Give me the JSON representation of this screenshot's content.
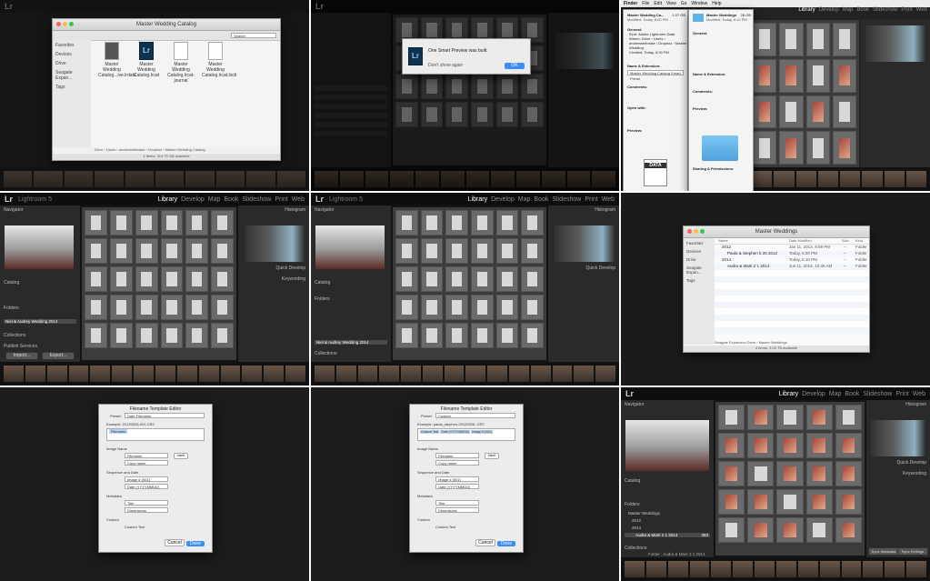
{
  "cell1": {
    "window_title": "Master Wedding Catalog",
    "sidebar": [
      "Favorites",
      "Devices",
      "Drive",
      "Seagate Expan...",
      "Tags"
    ],
    "files": [
      "Master Wedding Catalog...ive.lrdata",
      "Master Wedding Catalog.lrcat",
      "Master Wedding Catalog.lrcat-journal",
      "Master Wedding Catalog.lrcat.lock"
    ],
    "status": "4 items, 319.75 GB available",
    "search_placeholder": "Search",
    "path": "Drive › Users › andrewsinfosise › Dropbox › Master Wedding Catalog"
  },
  "cell2": {
    "dialog_text": "One Smart Preview was built.",
    "checkbox": "Don't show again",
    "ok": "OK",
    "icon": "Lr"
  },
  "cell3": {
    "menubar": [
      "Finder",
      "File",
      "Edit",
      "View",
      "Go",
      "Window",
      "Help"
    ],
    "info1_title": "Master Wedding Ca...",
    "info1_size": "1.07 GB",
    "info1_modified": "Modified: Today, 6:00 PM",
    "info2_title": "Master Weddings",
    "info2_size": "28 GB",
    "info2_modified": "Modified: Today, 6:10 PM",
    "general": "General:",
    "kind1": "Kind: Adobe Lightroom Data",
    "where": "Where: Drive › Users › andrewsinfosise › Dropbox › Master Wedding",
    "created": "Created: Today, 6:00 PM",
    "name_ext": "Name & Extension:",
    "name_value": "Master Wedding Catalog Smart Previe",
    "comments": "Comments:",
    "open_with": "Open with:",
    "preview": "Preview:",
    "sharing": "Sharing & Permissions:",
    "data_label": "DATA",
    "module_tabs": [
      "Library",
      "Develop",
      "Map",
      "Book",
      "Slideshow",
      "Print",
      "Web"
    ]
  },
  "lr_modules": [
    "Library",
    "Develop",
    "Map",
    "Book",
    "Slideshow",
    "Print",
    "Web"
  ],
  "lr_logo": "Lr",
  "lr_logo_text": "Lightroom 5",
  "lr_panels": {
    "navigator": "Navigator",
    "catalog": "Catalog",
    "folders": "Folders",
    "collections": "Collections",
    "publish": "Publish Services",
    "histogram": "Histogram",
    "quick_develop": "Quick Develop",
    "keywording": "Keywording",
    "import": "Import...",
    "export": "Export...",
    "folder_item": "Niel & Audrey Wedding 2014",
    "sync": "Sync Settings",
    "sync_meta": "Sync Metadata"
  },
  "cell6": {
    "window_title": "Master Weddings",
    "columns": [
      "Name",
      "Date Modified",
      "Size",
      "Kind"
    ],
    "rows": [
      {
        "name": "2012",
        "date": "Jan 11, 2013, 8:59 PM",
        "size": "--",
        "kind": "Folder"
      },
      {
        "name": "Paula & Stephen 5 26 2012",
        "date": "Today, 6:30 PM",
        "size": "--",
        "kind": "Folder"
      },
      {
        "name": "2014",
        "date": "Today, 6:10 PM",
        "size": "--",
        "kind": "Folder"
      },
      {
        "name": "Audra & Mark 2 1 2014",
        "date": "Jun 11, 2014, 10:35 AM",
        "size": "--",
        "kind": "Folder"
      }
    ],
    "status": "4 items, 3.00 TB available",
    "path": "Seagate Expansion Drive › Master Weddings",
    "sidebar": [
      "Favorites",
      "Devices",
      "Drive",
      "Seagate Expan...",
      "Tags"
    ]
  },
  "cell7": {
    "title": "Filename Template Editor",
    "preset_label": "Preset:",
    "preset_value": "Date-Filename",
    "example": "Example: 20120526-001.CR2",
    "token": "Filename",
    "image_name": "Image Name",
    "filename": "Filename",
    "copy_name": "Copy name",
    "seq": "Sequence and Date",
    "image_num": "Image # (001)",
    "date": "Date (YYYYMMDD)",
    "metadata": "Metadata",
    "title_field": "Title",
    "dimensions": "Dimensions",
    "custom": "Custom",
    "custom_text": "Custom Text",
    "insert": "Insert",
    "cancel": "Cancel",
    "done": "Done"
  },
  "cell8": {
    "title": "Filename Template Editor",
    "preset_label": "Preset:",
    "preset_value": "Custom",
    "example": "Example: paula_stephen-20120526-.CR2",
    "tokens": [
      "Custom Text",
      "Date (YYYYMMDD)",
      "Image # (001)"
    ],
    "cancel": "Cancel",
    "done": "Done",
    "insert": "Insert"
  },
  "cell9": {
    "catalog_header": "Master Weddings",
    "folder_2012": "2012",
    "folder_2014": "2014",
    "folder_audra": "Audra & Mark 2 1 2014",
    "count": "383",
    "filmstrip_info": "Folder : Audra & Mark 2 1 2014"
  },
  "colors": {
    "lr_bg": "#1a1a1a",
    "lr_panel": "#2a2a2a",
    "lr_grid": "#3b3b3b",
    "mac_blue": "#3d8ef3",
    "lr_accent": "#0e3350"
  }
}
